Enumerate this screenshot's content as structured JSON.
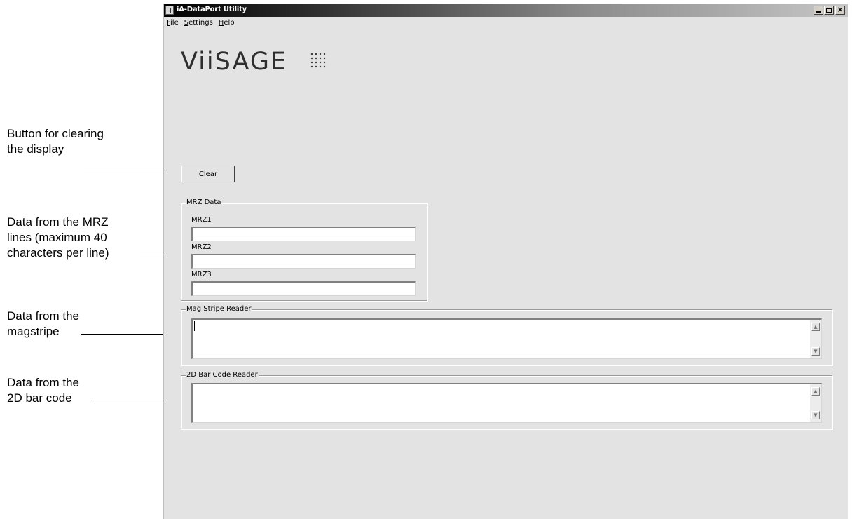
{
  "annotations": {
    "clear": [
      "Button for clearing",
      "the display"
    ],
    "mrz": [
      "Data from the MRZ",
      "lines (maximum 40",
      "characters per line)"
    ],
    "magstripe": [
      "Data from the",
      "magstripe"
    ],
    "barcode": [
      "Data from the",
      "2D bar code"
    ]
  },
  "window": {
    "title": "iA-DataPort Utility",
    "menus": [
      {
        "label": "File",
        "accel": "F",
        "rest": "ile"
      },
      {
        "label": "Settings",
        "accel": "S",
        "rest": "ettings"
      },
      {
        "label": "Help",
        "accel": "H",
        "rest": "elp"
      }
    ],
    "logo": "ViiSAGE",
    "clear_button": "Clear",
    "mrz_group": {
      "legend": "MRZ Data",
      "fields": [
        {
          "label": "MRZ1",
          "value": ""
        },
        {
          "label": "MRZ2",
          "value": ""
        },
        {
          "label": "MRZ3",
          "value": ""
        }
      ]
    },
    "mag_group": {
      "legend": "Mag Stripe Reader",
      "value": ""
    },
    "barcode_group": {
      "legend": "2D Bar Code Reader",
      "value": ""
    }
  }
}
